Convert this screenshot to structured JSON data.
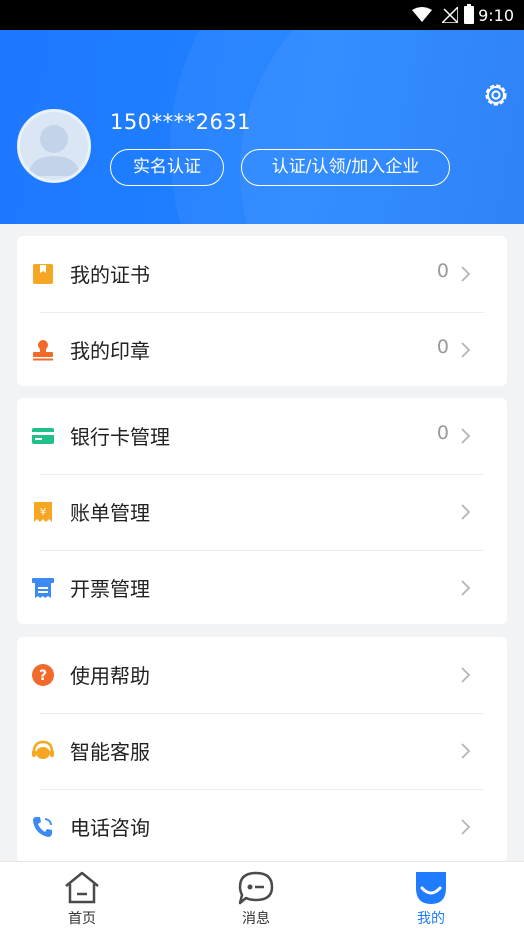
{
  "status_bar": {
    "time": "9:10"
  },
  "profile": {
    "phone": "150****2631",
    "realname_button": "实名认证",
    "enterprise_button": "认证/认领/加入企业"
  },
  "groups": [
    {
      "items": [
        {
          "label": "我的证书",
          "count": "0",
          "icon": "certificate-icon",
          "color": "#f5a623"
        },
        {
          "label": "我的印章",
          "count": "0",
          "icon": "seal-icon",
          "color": "#f26a2b"
        }
      ]
    },
    {
      "items": [
        {
          "label": "银行卡管理",
          "count": "0",
          "icon": "bank-card-icon",
          "color": "#1fc08b"
        },
        {
          "label": "账单管理",
          "count": "",
          "icon": "bill-icon",
          "color": "#f5a623"
        },
        {
          "label": "开票管理",
          "count": "",
          "icon": "invoice-icon",
          "color": "#3d8bf2"
        }
      ]
    },
    {
      "items": [
        {
          "label": "使用帮助",
          "count": "",
          "icon": "help-icon",
          "color": "#f26a2b"
        },
        {
          "label": "智能客服",
          "count": "",
          "icon": "customer-service-icon",
          "color": "#f5a623"
        },
        {
          "label": "电话咨询",
          "count": "",
          "icon": "phone-icon",
          "color": "#3d8bf2"
        }
      ]
    }
  ],
  "tabs": [
    {
      "label": "首页",
      "icon": "home-icon",
      "active": false
    },
    {
      "label": "消息",
      "icon": "message-icon",
      "active": false
    },
    {
      "label": "我的",
      "icon": "profile-icon",
      "active": true
    }
  ],
  "colors": {
    "primary": "#1f7cff",
    "background": "#f2f3f5"
  }
}
